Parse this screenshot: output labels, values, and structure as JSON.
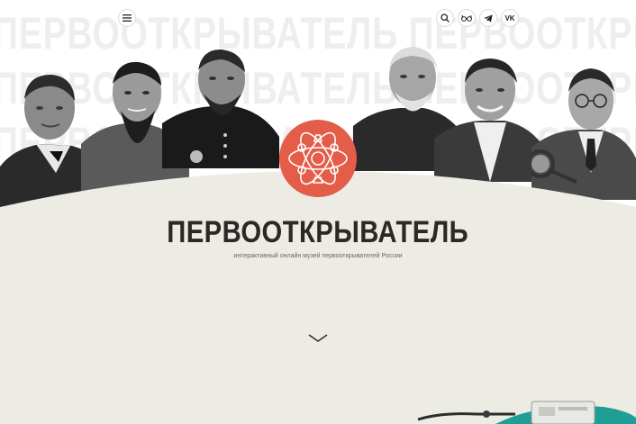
{
  "header": {
    "menu_icon": "hamburger-menu-icon",
    "actions": [
      {
        "name": "search",
        "icon": "search-icon"
      },
      {
        "name": "accessibility-glasses",
        "icon": "glasses-icon"
      },
      {
        "name": "telegram",
        "icon": "telegram-icon"
      },
      {
        "name": "vk",
        "icon": "vk-icon",
        "label": "VK"
      }
    ]
  },
  "background_word": "ПЕРВООТКРЫВАТЕЛЬ ПЕРВООТКРЫВАТЕЛЬ ПЕРВООТКРЫВАТЕЛЬ",
  "hero": {
    "title": "ПЕРВООТКРЫВАТЕЛЬ",
    "subtitle": "интерактивный онлайн музей первооткрывателей России",
    "emblem_icon": "atom-emblem-icon",
    "scroll_icon": "chevron-down-icon"
  },
  "colors": {
    "beige": "#ecebe4",
    "emblem": "#e35d49",
    "title": "#2b2825",
    "bg_word": "#eeeeee",
    "teal": "#1f9e95"
  }
}
